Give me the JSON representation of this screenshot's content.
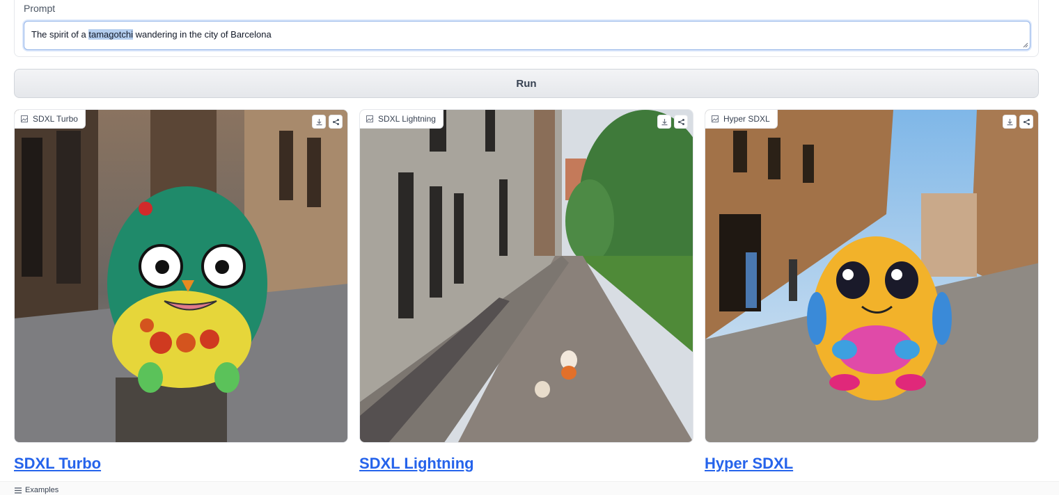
{
  "prompt": {
    "label": "Prompt",
    "text_before": "The spirit of a ",
    "text_selected": "tamagotchi",
    "text_after": " wandering in the city of Barcelona"
  },
  "run_button": {
    "label": "Run"
  },
  "outputs": [
    {
      "label": "SDXL Turbo",
      "link": "SDXL Turbo"
    },
    {
      "label": "SDXL Lightning",
      "link": "SDXL Lightning"
    },
    {
      "label": "Hyper SDXL",
      "link": "Hyper SDXL"
    }
  ],
  "examples": {
    "label": "Examples"
  },
  "colors": {
    "accent_link": "#2563eb",
    "selection": "#b3cdee",
    "focus_border": "#93b4e8"
  },
  "icons": [
    "image-icon",
    "download-icon",
    "share-icon",
    "list-icon"
  ]
}
